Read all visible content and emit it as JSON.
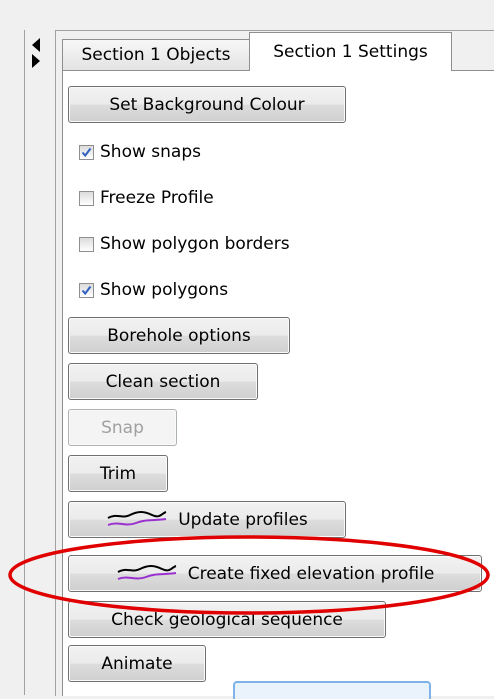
{
  "tabs": [
    {
      "label": "Section 1 Objects",
      "active": false
    },
    {
      "label": "Section 1 Settings",
      "active": true
    }
  ],
  "buttons": {
    "set_background": "Set Background Colour",
    "borehole_options": "Borehole options",
    "clean_section": "Clean section",
    "snap": "Snap",
    "trim": "Trim",
    "update_profiles": "Update profiles",
    "create_fixed_elevation": "Create fixed elevation profile",
    "check_geological": "Check geological sequence",
    "animate": "Animate"
  },
  "checkboxes": [
    {
      "label": "Show snaps",
      "checked": true
    },
    {
      "label": "Freeze Profile",
      "checked": false
    },
    {
      "label": "Show polygon borders",
      "checked": false
    },
    {
      "label": "Show polygons",
      "checked": true
    }
  ],
  "colors": {
    "highlight_ellipse": "#e00000",
    "profile_line_black": "#000000",
    "profile_line_purple": "#9b30d0",
    "check_mark": "#3060c0"
  },
  "icons": {
    "collapse_left": "triangle-left-icon",
    "expand_right": "triangle-right-icon",
    "profile": "profile-lines-icon"
  }
}
